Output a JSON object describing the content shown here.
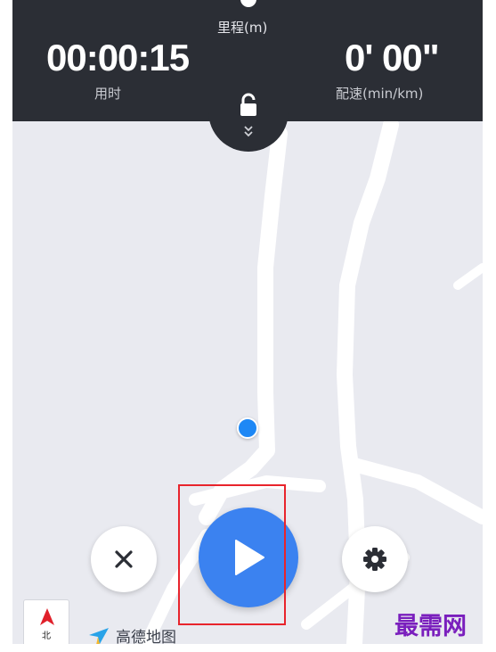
{
  "stats": {
    "duration_value": "00:00:15",
    "duration_label": "用时",
    "distance_label": "里程(m)",
    "pace_value": "0' 00\"",
    "pace_label": "配速(min/km)"
  },
  "controls": {
    "close_icon": "close-icon",
    "play_icon": "play-icon",
    "settings_icon": "gear-icon",
    "lock_icon": "lock-icon",
    "expand_icon": "chevron-double-down-icon"
  },
  "map": {
    "compass_label": "北",
    "provider_name": "高德地图"
  },
  "watermark": "最需网",
  "colors": {
    "stats_bar": "#2b2e35",
    "play_button": "#3b82f0",
    "location_dot": "#1e88f5",
    "highlight_box": "#e8242c",
    "map_background": "#e9eaf0",
    "watermark": "#7a1fbd"
  }
}
